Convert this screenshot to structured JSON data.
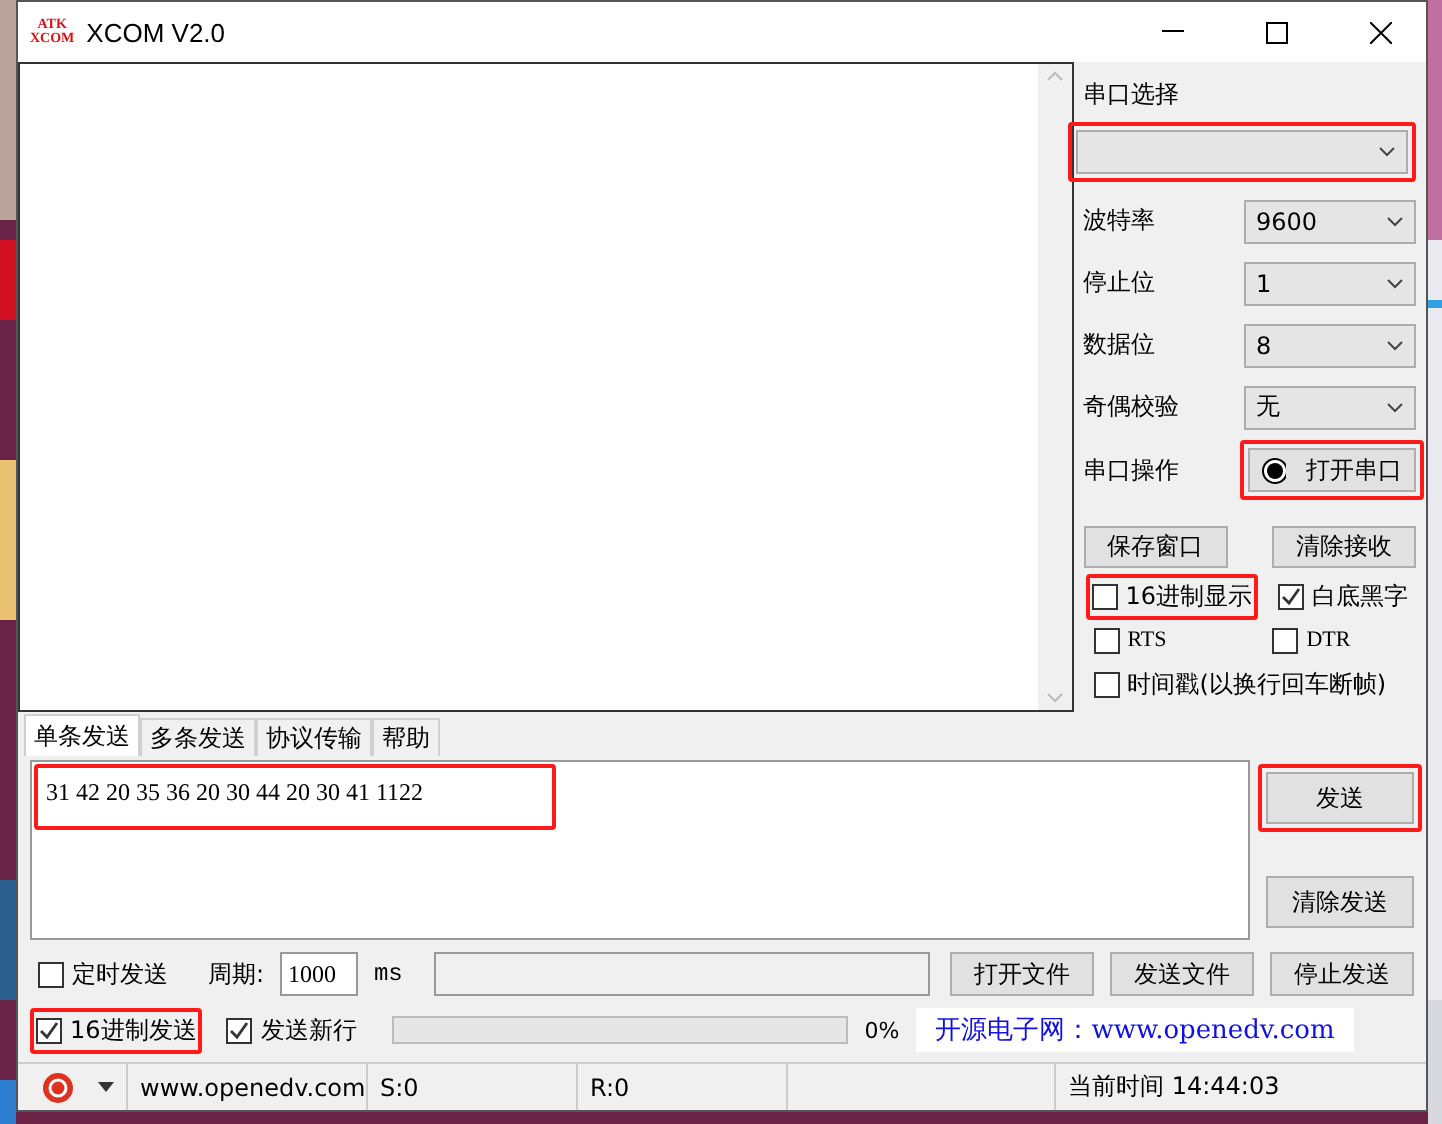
{
  "window": {
    "logo_top": "ATK",
    "logo_bottom": "XCOM",
    "title": "XCOM V2.0"
  },
  "port_select": {
    "label": "串口选择",
    "highlighted": true
  },
  "settings": [
    {
      "label": "波特率",
      "value": "9600"
    },
    {
      "label": "停止位",
      "value": "1"
    },
    {
      "label": "数据位",
      "value": "8"
    },
    {
      "label": "奇偶校验",
      "value": "无"
    }
  ],
  "port_operation": {
    "label": "串口操作",
    "button": "打开串口",
    "highlighted": true
  },
  "receive_buttons": [
    "保存窗口",
    "清除接收"
  ],
  "receive_options": [
    {
      "label": "16进制显示",
      "checked": false,
      "highlighted": true
    },
    {
      "label": "白底黑字",
      "checked": true,
      "highlighted": false
    },
    {
      "label": "RTS",
      "checked": false,
      "highlighted": false
    },
    {
      "label": "DTR",
      "checked": false,
      "highlighted": false
    },
    {
      "label": "时间戳(以换行回车断帧)",
      "checked": false,
      "highlighted": false
    }
  ],
  "tabs": [
    {
      "label": "单条发送",
      "selected": true
    },
    {
      "label": "多条发送",
      "selected": false
    },
    {
      "label": "协议传输",
      "selected": false
    },
    {
      "label": "帮助",
      "selected": false
    }
  ],
  "send_text": {
    "value": "31 42 20 35 36 20 30 44 20 30 41 1122",
    "highlighted": true
  },
  "send_buttons": [
    {
      "label": "发送",
      "highlighted": true
    },
    {
      "label": "清除发送",
      "highlighted": false
    }
  ],
  "timed_send": {
    "label": "定时发送",
    "checked": false
  },
  "period": {
    "label": "周期:",
    "value": "1000",
    "unit": "ms"
  },
  "file_buttons": [
    "打开文件",
    "发送文件",
    "停止发送"
  ],
  "send_options": [
    {
      "label": "16进制发送",
      "checked": true,
      "highlighted": true
    },
    {
      "label": "发送新行",
      "checked": true,
      "highlighted": false
    }
  ],
  "progress": {
    "level": 0,
    "reading": "0%"
  },
  "banner": "开源电子网：www.openedv.com",
  "status_bar": {
    "url": "www.openedv.com",
    "sent": "S:0",
    "received": "R:0",
    "time": "当前时间 14:44:03"
  }
}
